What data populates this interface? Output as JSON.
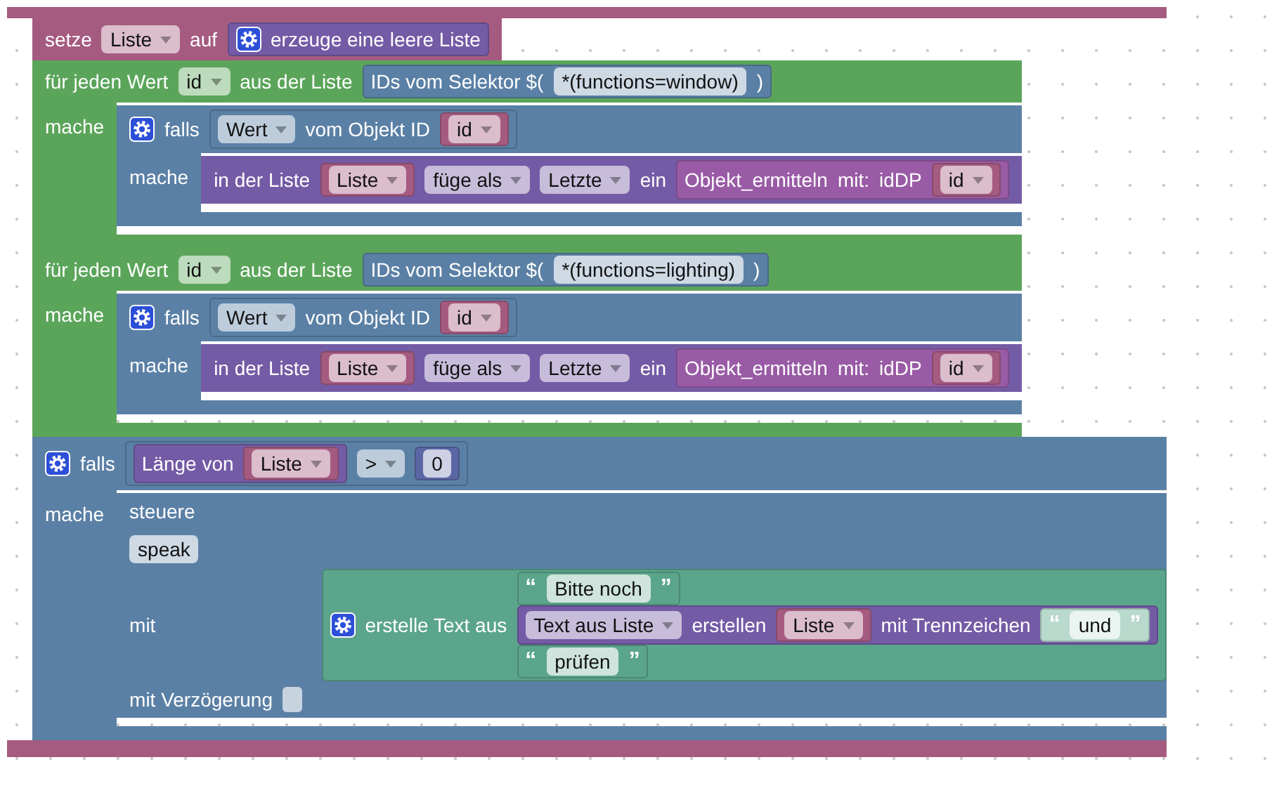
{
  "script": {
    "kind": "event",
    "statements": [
      {
        "kind": "variable",
        "rows": [
          {
            "items": [
              {
                "kind": "label",
                "text": "setze"
              },
              {
                "kind": "dropdown",
                "text": "Liste"
              },
              {
                "kind": "label",
                "text": "auf"
              },
              {
                "kind": "block",
                "block": {
                  "kind": "list",
                  "rows": [
                    {
                      "items": [
                        {
                          "kind": "gear"
                        },
                        {
                          "kind": "label",
                          "text": "erzeuge eine leere Liste"
                        }
                      ]
                    }
                  ]
                }
              }
            ]
          }
        ]
      },
      {
        "kind": "loop",
        "rows": [
          {
            "items": [
              {
                "kind": "label",
                "text": "für jeden Wert"
              },
              {
                "kind": "dropdown",
                "text": "id"
              },
              {
                "kind": "label",
                "text": "aus der Liste"
              },
              {
                "kind": "block",
                "block": {
                  "kind": "selector",
                  "rows": [
                    {
                      "items": [
                        {
                          "kind": "label",
                          "text": "IDs vom Selektor $("
                        },
                        {
                          "kind": "field",
                          "text": "*(functions=window)"
                        },
                        {
                          "kind": "label",
                          "text": ")"
                        }
                      ]
                    }
                  ]
                }
              }
            ]
          },
          {
            "items": [
              {
                "kind": "label",
                "text": "mache"
              }
            ],
            "body": [
              {
                "kind": "logic",
                "rows": [
                  {
                    "items": [
                      {
                        "kind": "gear"
                      },
                      {
                        "kind": "label",
                        "text": "falls"
                      },
                      {
                        "kind": "block",
                        "block": {
                          "kind": "selector",
                          "rows": [
                            {
                              "items": [
                                {
                                  "kind": "dropdown",
                                  "text": "Wert"
                                },
                                {
                                  "kind": "label",
                                  "text": "vom Objekt ID"
                                },
                                {
                                  "kind": "block",
                                  "block": {
                                    "kind": "variable",
                                    "rows": [
                                      {
                                        "items": [
                                          {
                                            "kind": "dropdown",
                                            "text": "id"
                                          }
                                        ]
                                      }
                                    ]
                                  }
                                }
                              ]
                            }
                          ]
                        }
                      }
                    ]
                  },
                  {
                    "items": [
                      {
                        "kind": "label",
                        "text": "mache"
                      }
                    ],
                    "body": [
                      {
                        "kind": "list",
                        "rows": [
                          {
                            "items": [
                              {
                                "kind": "label",
                                "text": "in der Liste"
                              },
                              {
                                "kind": "block",
                                "block": {
                                  "kind": "variable",
                                  "rows": [
                                    {
                                      "items": [
                                        {
                                          "kind": "dropdown",
                                          "text": "Liste"
                                        }
                                      ]
                                    }
                                  ]
                                }
                              },
                              {
                                "kind": "dropdown",
                                "text": "füge als"
                              },
                              {
                                "kind": "dropdown",
                                "text": "Letzte"
                              },
                              {
                                "kind": "label",
                                "text": "ein"
                              },
                              {
                                "kind": "block",
                                "block": {
                                  "kind": "function",
                                  "rows": [
                                    {
                                      "items": [
                                        {
                                          "kind": "label",
                                          "text": "Objekt_ermitteln"
                                        },
                                        {
                                          "kind": "label",
                                          "text": "mit:"
                                        },
                                        {
                                          "kind": "label",
                                          "text": "idDP"
                                        },
                                        {
                                          "kind": "block",
                                          "block": {
                                            "kind": "variable",
                                            "rows": [
                                              {
                                                "items": [
                                                  {
                                                    "kind": "dropdown",
                                                    "text": "id"
                                                  }
                                                ]
                                              }
                                            ]
                                          }
                                        }
                                      ]
                                    }
                                  ]
                                }
                              }
                            ]
                          }
                        ]
                      }
                    ]
                  }
                ]
              }
            ]
          }
        ]
      },
      {
        "kind": "loop",
        "rows": [
          {
            "items": [
              {
                "kind": "label",
                "text": "für jeden Wert"
              },
              {
                "kind": "dropdown",
                "text": "id"
              },
              {
                "kind": "label",
                "text": "aus der Liste"
              },
              {
                "kind": "block",
                "block": {
                  "kind": "selector",
                  "rows": [
                    {
                      "items": [
                        {
                          "kind": "label",
                          "text": "IDs vom Selektor $("
                        },
                        {
                          "kind": "field",
                          "text": "*(functions=lighting)"
                        },
                        {
                          "kind": "label",
                          "text": ")"
                        }
                      ]
                    }
                  ]
                }
              }
            ]
          },
          {
            "items": [
              {
                "kind": "label",
                "text": "mache"
              }
            ],
            "body": [
              {
                "kind": "logic",
                "rows": [
                  {
                    "items": [
                      {
                        "kind": "gear"
                      },
                      {
                        "kind": "label",
                        "text": "falls"
                      },
                      {
                        "kind": "block",
                        "block": {
                          "kind": "selector",
                          "rows": [
                            {
                              "items": [
                                {
                                  "kind": "dropdown",
                                  "text": "Wert"
                                },
                                {
                                  "kind": "label",
                                  "text": "vom Objekt ID"
                                },
                                {
                                  "kind": "block",
                                  "block": {
                                    "kind": "variable",
                                    "rows": [
                                      {
                                        "items": [
                                          {
                                            "kind": "dropdown",
                                            "text": "id"
                                          }
                                        ]
                                      }
                                    ]
                                  }
                                }
                              ]
                            }
                          ]
                        }
                      }
                    ]
                  },
                  {
                    "items": [
                      {
                        "kind": "label",
                        "text": "mache"
                      }
                    ],
                    "body": [
                      {
                        "kind": "list",
                        "rows": [
                          {
                            "items": [
                              {
                                "kind": "label",
                                "text": "in der Liste"
                              },
                              {
                                "kind": "block",
                                "block": {
                                  "kind": "variable",
                                  "rows": [
                                    {
                                      "items": [
                                        {
                                          "kind": "dropdown",
                                          "text": "Liste"
                                        }
                                      ]
                                    }
                                  ]
                                }
                              },
                              {
                                "kind": "dropdown",
                                "text": "füge als"
                              },
                              {
                                "kind": "dropdown",
                                "text": "Letzte"
                              },
                              {
                                "kind": "label",
                                "text": "ein"
                              },
                              {
                                "kind": "block",
                                "block": {
                                  "kind": "function",
                                  "rows": [
                                    {
                                      "items": [
                                        {
                                          "kind": "label",
                                          "text": "Objekt_ermitteln"
                                        },
                                        {
                                          "kind": "label",
                                          "text": "mit:"
                                        },
                                        {
                                          "kind": "label",
                                          "text": "idDP"
                                        },
                                        {
                                          "kind": "block",
                                          "block": {
                                            "kind": "variable",
                                            "rows": [
                                              {
                                                "items": [
                                                  {
                                                    "kind": "dropdown",
                                                    "text": "id"
                                                  }
                                                ]
                                              }
                                            ]
                                          }
                                        }
                                      ]
                                    }
                                  ]
                                }
                              }
                            ]
                          }
                        ]
                      }
                    ]
                  }
                ]
              }
            ]
          }
        ]
      },
      {
        "kind": "logic",
        "rows": [
          {
            "items": [
              {
                "kind": "gear"
              },
              {
                "kind": "label",
                "text": "falls"
              },
              {
                "kind": "block",
                "block": {
                  "kind": "compare",
                  "rows": [
                    {
                      "items": [
                        {
                          "kind": "block",
                          "block": {
                            "kind": "list",
                            "rows": [
                              {
                                "items": [
                                  {
                                    "kind": "label",
                                    "text": "Länge von"
                                  },
                                  {
                                    "kind": "block",
                                    "block": {
                                      "kind": "variable",
                                      "rows": [
                                        {
                                          "items": [
                                            {
                                              "kind": "dropdown",
                                              "text": "Liste"
                                            }
                                          ]
                                        }
                                      ]
                                    }
                                  }
                                ]
                              }
                            ]
                          }
                        },
                        {
                          "kind": "dropdown",
                          "text": ">"
                        },
                        {
                          "kind": "block",
                          "block": {
                            "kind": "math",
                            "rows": [
                              {
                                "items": [
                                  {
                                    "kind": "field",
                                    "text": "0"
                                  }
                                ]
                              }
                            ]
                          }
                        }
                      ]
                    }
                  ]
                }
              }
            ]
          },
          {
            "items": [
              {
                "kind": "label",
                "text": "mache"
              }
            ],
            "body": [
              {
                "kind": "control",
                "rows": [
                  {
                    "items": [
                      {
                        "kind": "label",
                        "text": "steuere"
                      }
                    ]
                  },
                  {
                    "items": [
                      {
                        "kind": "field",
                        "text": "speak"
                      }
                    ]
                  },
                  {
                    "items": [
                      {
                        "kind": "label",
                        "text": "mit"
                      },
                      {
                        "kind": "block",
                        "block": {
                          "kind": "text",
                          "rows": [
                            {
                              "items": [
                                {
                                  "kind": "gear"
                                },
                                {
                                  "kind": "label",
                                  "text": "erstelle Text aus"
                                },
                                {
                                  "kind": "stack",
                                  "blocks": [
                                    {
                                      "kind": "text",
                                      "rows": [
                                        {
                                          "items": [
                                            {
                                              "kind": "quote",
                                              "text": "“"
                                            },
                                            {
                                              "kind": "field",
                                              "text": "Bitte noch"
                                            },
                                            {
                                              "kind": "quote",
                                              "text": "”"
                                            }
                                          ]
                                        }
                                      ]
                                    },
                                    {
                                      "kind": "list",
                                      "rows": [
                                        {
                                          "items": [
                                            {
                                              "kind": "dropdown",
                                              "text": "Text aus Liste"
                                            },
                                            {
                                              "kind": "label",
                                              "text": "erstellen"
                                            },
                                            {
                                              "kind": "block",
                                              "block": {
                                                "kind": "variable",
                                                "rows": [
                                                  {
                                                    "items": [
                                                      {
                                                        "kind": "dropdown",
                                                        "text": "Liste"
                                                      }
                                                    ]
                                                  }
                                                ]
                                              }
                                            },
                                            {
                                              "kind": "label",
                                              "text": "mit Trennzeichen"
                                            },
                                            {
                                              "kind": "block",
                                              "block": {
                                                "kind": "text_shadow",
                                                "rows": [
                                                  {
                                                    "items": [
                                                      {
                                                        "kind": "quote",
                                                        "text": "“"
                                                      },
                                                      {
                                                        "kind": "field",
                                                        "text": "und"
                                                      },
                                                      {
                                                        "kind": "quote",
                                                        "text": "”"
                                                      }
                                                    ]
                                                  }
                                                ]
                                              }
                                            }
                                          ]
                                        }
                                      ]
                                    },
                                    {
                                      "kind": "text",
                                      "rows": [
                                        {
                                          "items": [
                                            {
                                              "kind": "quote",
                                              "text": "“"
                                            },
                                            {
                                              "kind": "field",
                                              "text": "prüfen"
                                            },
                                            {
                                              "kind": "quote",
                                              "text": "”"
                                            }
                                          ]
                                        }
                                      ]
                                    }
                                  ]
                                }
                              ]
                            }
                          ]
                        }
                      }
                    ]
                  },
                  {
                    "items": [
                      {
                        "kind": "label",
                        "text": "mit Verzögerung"
                      },
                      {
                        "kind": "socket"
                      }
                    ]
                  }
                ]
              }
            ]
          }
        ]
      }
    ]
  }
}
